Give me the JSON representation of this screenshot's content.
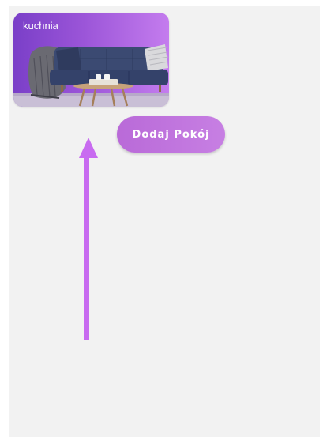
{
  "room_list": {
    "rooms": [
      {
        "name": "kuchnia",
        "image": "living-room-sofa-photo"
      }
    ]
  },
  "actions": {
    "add_room_label": "Dodaj Pokój"
  },
  "annotation": {
    "icon": "arrow-up-icon",
    "color": "#c86bf0"
  },
  "colors": {
    "card_gradient_start": "#7a3fc8",
    "card_gradient_end": "#c47cee",
    "button": "#c077e0",
    "background": "#f2f2f2"
  }
}
